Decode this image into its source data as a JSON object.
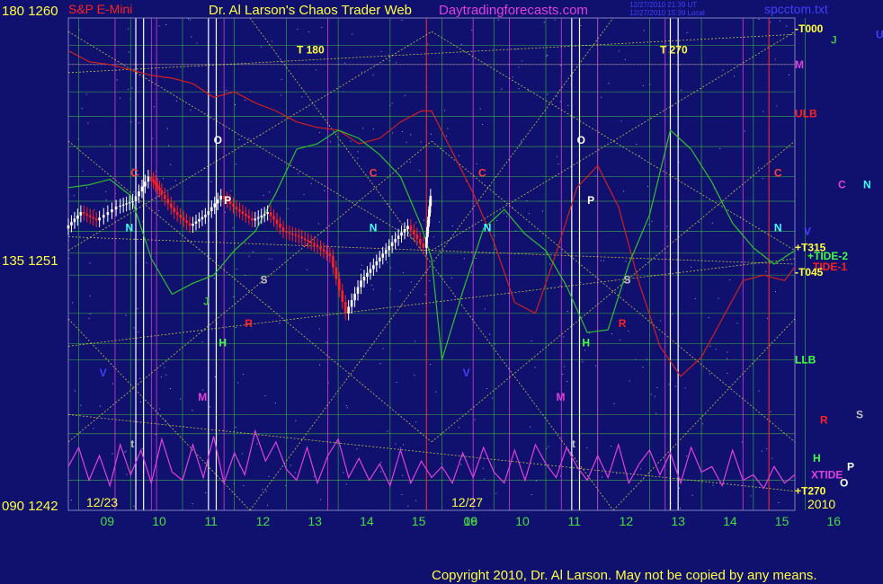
{
  "header": {
    "ylabel_top": "180  1260",
    "ylabel_mid": "135  1251",
    "ylabel_bot": "090  1242",
    "instrument": "S&P E-Mini",
    "title": "Dr. Al Larson's Chaos Trader Web",
    "site": "Daytradingforecasts.com",
    "timestamp_line1": "12/27/2010 21:39 UT",
    "timestamp_line2": "12/27/2010 15:39 Local",
    "file": "spcctom.txt"
  },
  "footer": {
    "copyright": "Copyright 2010, Dr. Al Larson. May not be copied by any means.",
    "year": "2010"
  },
  "colors": {
    "background": "#10106e",
    "price_up": "#ffffff",
    "price_down": "#ff2020",
    "grid_green": "#40c040",
    "diag_yellow": "#e0e040",
    "magenta": "#e040e0",
    "red_line": "#d02020",
    "green_line": "#30c030",
    "hour_label": "#40e040"
  },
  "chart_data": {
    "type": "line",
    "ylim": [
      1242,
      1260
    ],
    "y_ticks": [
      1242,
      1251,
      1260
    ],
    "x_sessions": [
      "12/23",
      "12/27"
    ],
    "x_ticks": [
      "09",
      "10",
      "11",
      "12",
      "13",
      "14",
      "15",
      "16",
      "09",
      "10",
      "11",
      "12",
      "13",
      "14",
      "15",
      "16"
    ],
    "series": [
      {
        "name": "price",
        "x": [
          0,
          0.3,
          0.6,
          1.0,
          1.3,
          1.6,
          1.8,
          2.1,
          2.4,
          2.7,
          3.0,
          3.3,
          3.6,
          3.9,
          4.2,
          4.5,
          4.8,
          5.1,
          5.4,
          5.7,
          6.0,
          6.3,
          6.6,
          6.9,
          7.0
        ],
        "values": [
          1252.3,
          1252.9,
          1252.6,
          1253.1,
          1253.3,
          1254.2,
          1253.7,
          1252.9,
          1252.4,
          1252.8,
          1253.5,
          1253.0,
          1252.6,
          1252.9,
          1252.2,
          1252.0,
          1251.7,
          1251.3,
          1249.2,
          1250.4,
          1251.1,
          1251.8,
          1252.4,
          1251.6,
          1253.5
        ]
      },
      {
        "name": "red",
        "x": [
          0,
          0.4,
          0.8,
          1.2,
          1.6,
          2.0,
          2.4,
          2.8,
          3.2,
          3.6,
          4.0,
          4.4,
          4.8,
          5.2,
          5.6,
          6.0,
          6.4,
          6.8,
          7.0,
          7.4,
          7.8,
          8.2,
          8.6,
          9.0,
          9.4,
          9.8,
          10.2,
          10.6,
          11.0,
          11.4,
          11.8,
          12.2,
          12.6,
          13.0,
          13.4,
          13.8,
          14.0
        ],
        "values": [
          1258.8,
          1258.4,
          1258.3,
          1258.1,
          1257.9,
          1257.8,
          1257.6,
          1257.1,
          1257.3,
          1256.9,
          1256.6,
          1256.2,
          1256.0,
          1255.9,
          1255.4,
          1255.6,
          1256.2,
          1256.6,
          1256.6,
          1255.1,
          1253.6,
          1251.8,
          1249.6,
          1249.2,
          1251.4,
          1253.8,
          1254.6,
          1253.1,
          1250.3,
          1248.0,
          1246.9,
          1247.6,
          1249.0,
          1250.4,
          1250.6,
          1250.4,
          1250.9
        ]
      },
      {
        "name": "green",
        "x": [
          0,
          0.4,
          0.8,
          1.2,
          1.6,
          2.0,
          2.4,
          2.8,
          3.2,
          3.6,
          4.0,
          4.4,
          4.8,
          5.2,
          5.6,
          6.0,
          6.4,
          6.8,
          7.0,
          7.2,
          7.6,
          8.0,
          8.4,
          8.8,
          9.2,
          9.6,
          10.0,
          10.4,
          10.8,
          11.2,
          11.6,
          12.0,
          12.4,
          12.8,
          13.2,
          13.6,
          14.0
        ],
        "values": [
          1253.8,
          1253.9,
          1254.1,
          1253.5,
          1251.2,
          1249.9,
          1250.3,
          1250.6,
          1251.5,
          1252.2,
          1253.6,
          1255.2,
          1255.4,
          1255.9,
          1255.6,
          1255.0,
          1254.2,
          1252.4,
          1251.2,
          1247.5,
          1250.0,
          1252.3,
          1253.0,
          1252.1,
          1251.5,
          1250.2,
          1248.5,
          1248.6,
          1251.0,
          1252.8,
          1255.9,
          1255.2,
          1254.0,
          1252.5,
          1251.6,
          1251.0,
          1251.5
        ]
      },
      {
        "name": "XTIDE",
        "x": [
          0,
          0.2,
          0.4,
          0.6,
          0.8,
          1.0,
          1.2,
          1.4,
          1.6,
          1.8,
          2.0,
          2.2,
          2.4,
          2.6,
          2.8,
          3.0,
          3.2,
          3.4,
          3.6,
          3.8,
          4.0,
          4.2,
          4.4,
          4.6,
          4.8,
          5.0,
          5.2,
          5.4,
          5.6,
          5.8,
          6.0,
          6.2,
          6.4,
          6.6,
          6.8,
          7.0,
          7.2,
          7.4,
          7.6,
          7.8,
          8.0,
          8.2,
          8.4,
          8.6,
          8.8,
          9.0,
          9.2,
          9.4,
          9.6,
          9.8,
          10.0,
          10.2,
          10.4,
          10.6,
          10.8,
          11.0,
          11.2,
          11.4,
          11.6,
          11.8,
          12.0,
          12.2,
          12.4,
          12.6,
          12.8,
          13.0,
          13.2,
          13.4,
          13.6,
          13.8,
          14.0
        ],
        "values": [
          1243.6,
          1244.3,
          1243.1,
          1244.0,
          1242.9,
          1244.4,
          1243.3,
          1244.2,
          1243.0,
          1244.6,
          1243.4,
          1243.1,
          1244.4,
          1243.2,
          1244.7,
          1243.0,
          1244.1,
          1243.3,
          1244.9,
          1243.8,
          1244.5,
          1243.5,
          1243.1,
          1244.3,
          1243.0,
          1244.0,
          1244.6,
          1243.2,
          1243.9,
          1243.1,
          1243.7,
          1242.9,
          1244.2,
          1243.0,
          1243.8,
          1243.2,
          1243.6,
          1243.0,
          1244.1,
          1243.2,
          1244.3,
          1243.4,
          1243.0,
          1244.2,
          1243.1,
          1244.4,
          1243.7,
          1243.2,
          1244.3,
          1243.6,
          1243.1,
          1244.0,
          1243.2,
          1244.4,
          1243.0,
          1243.7,
          1244.2,
          1243.3,
          1244.1,
          1243.0,
          1244.3,
          1243.4,
          1243.6,
          1242.9,
          1244.2,
          1243.1,
          1243.3,
          1242.8,
          1243.6,
          1243.0,
          1243.3
        ]
      }
    ]
  },
  "markers": [
    {
      "text": "T 180",
      "x": 4.4,
      "y": 1258.7,
      "color": "#ffff40"
    },
    {
      "text": "T 270",
      "x": 11.4,
      "y": 1258.7,
      "color": "#ffff40"
    },
    {
      "text": "O",
      "x": 2.8,
      "y": 1255.4,
      "color": "#ffffff"
    },
    {
      "text": "O",
      "x": 9.8,
      "y": 1255.4,
      "color": "#ffffff"
    },
    {
      "text": "C",
      "x": 1.2,
      "y": 1254.2,
      "color": "#ff4040"
    },
    {
      "text": "C",
      "x": 5.8,
      "y": 1254.2,
      "color": "#ff4040"
    },
    {
      "text": "C",
      "x": 7.9,
      "y": 1254.2,
      "color": "#ff4040"
    },
    {
      "text": "C",
      "x": 13.6,
      "y": 1254.2,
      "color": "#ff4040"
    },
    {
      "text": "P",
      "x": 3.0,
      "y": 1253.2,
      "color": "#ffffff"
    },
    {
      "text": "P",
      "x": 10.0,
      "y": 1253.2,
      "color": "#ffffff"
    },
    {
      "text": "N",
      "x": 1.1,
      "y": 1252.2,
      "color": "#40ffff"
    },
    {
      "text": "N",
      "x": 5.8,
      "y": 1252.2,
      "color": "#40ffff"
    },
    {
      "text": "N",
      "x": 8.0,
      "y": 1252.2,
      "color": "#40ffff"
    },
    {
      "text": "N",
      "x": 13.6,
      "y": 1252.2,
      "color": "#40ffff"
    },
    {
      "text": "S",
      "x": 3.7,
      "y": 1250.3,
      "color": "#c0c0c0"
    },
    {
      "text": "S",
      "x": 10.7,
      "y": 1250.3,
      "color": "#c0c0c0"
    },
    {
      "text": "J",
      "x": 2.6,
      "y": 1249.5,
      "color": "#40c040"
    },
    {
      "text": "R",
      "x": 3.4,
      "y": 1248.7,
      "color": "#ff2020"
    },
    {
      "text": "R",
      "x": 10.6,
      "y": 1248.7,
      "color": "#ff2020"
    },
    {
      "text": "H",
      "x": 2.9,
      "y": 1248.0,
      "color": "#40ff40"
    },
    {
      "text": "H",
      "x": 9.9,
      "y": 1248.0,
      "color": "#40ff40"
    },
    {
      "text": "V",
      "x": 0.6,
      "y": 1246.9,
      "color": "#4040ff"
    },
    {
      "text": "V",
      "x": 7.6,
      "y": 1246.9,
      "color": "#4040ff"
    },
    {
      "text": "M",
      "x": 2.5,
      "y": 1246.0,
      "color": "#e040e0"
    },
    {
      "text": "M",
      "x": 9.4,
      "y": 1246.0,
      "color": "#e040e0"
    },
    {
      "text": "t",
      "x": 1.2,
      "y": 1244.3,
      "color": "#c0c0c0"
    },
    {
      "text": "t",
      "x": 9.7,
      "y": 1244.3,
      "color": "#c0c0c0"
    }
  ],
  "right_labels": [
    {
      "text": "-T000",
      "y": 1259.6,
      "color": "#ffff40"
    },
    {
      "text": "J",
      "y": 1259.2,
      "color": "#40c040",
      "dx": 40
    },
    {
      "text": "U",
      "y": 1259.4,
      "color": "#4040ff",
      "dx": 90
    },
    {
      "text": "M",
      "y": 1258.3,
      "color": "#e040e0"
    },
    {
      "text": "ULB",
      "y": 1256.5,
      "color": "#ff2020"
    },
    {
      "text": "C",
      "y": 1253.9,
      "color": "#e040e0",
      "dx": 48
    },
    {
      "text": "N",
      "y": 1253.9,
      "color": "#40ffff",
      "dx": 76
    },
    {
      "text": "V",
      "y": 1252.2,
      "color": "#4040ff",
      "dx": 10
    },
    {
      "text": "+T315",
      "y": 1251.6,
      "color": "#ffff40"
    },
    {
      "text": "+TIDE-2",
      "y": 1251.3,
      "color": "#40ff40",
      "dx": 14
    },
    {
      "text": "TIDE-1",
      "y": 1250.9,
      "color": "#ff2020",
      "dx": 20
    },
    {
      "text": "-T045",
      "y": 1250.7,
      "color": "#ffff40"
    },
    {
      "text": "LLB",
      "y": 1247.5,
      "color": "#40ff40"
    },
    {
      "text": "R",
      "y": 1245.3,
      "color": "#ff2020",
      "dx": 28
    },
    {
      "text": "S",
      "y": 1245.5,
      "color": "#c0c0c0",
      "dx": 68
    },
    {
      "text": "H",
      "y": 1243.9,
      "color": "#40ff40",
      "dx": 20
    },
    {
      "text": "P",
      "y": 1243.6,
      "color": "#ffffff",
      "dx": 58
    },
    {
      "text": "XTIDE",
      "y": 1243.3,
      "color": "#e040e0",
      "dx": 18
    },
    {
      "text": "O",
      "y": 1243.0,
      "color": "#ffffff",
      "dx": 50
    },
    {
      "text": "+T270",
      "y": 1242.7,
      "color": "#ffff40"
    }
  ]
}
